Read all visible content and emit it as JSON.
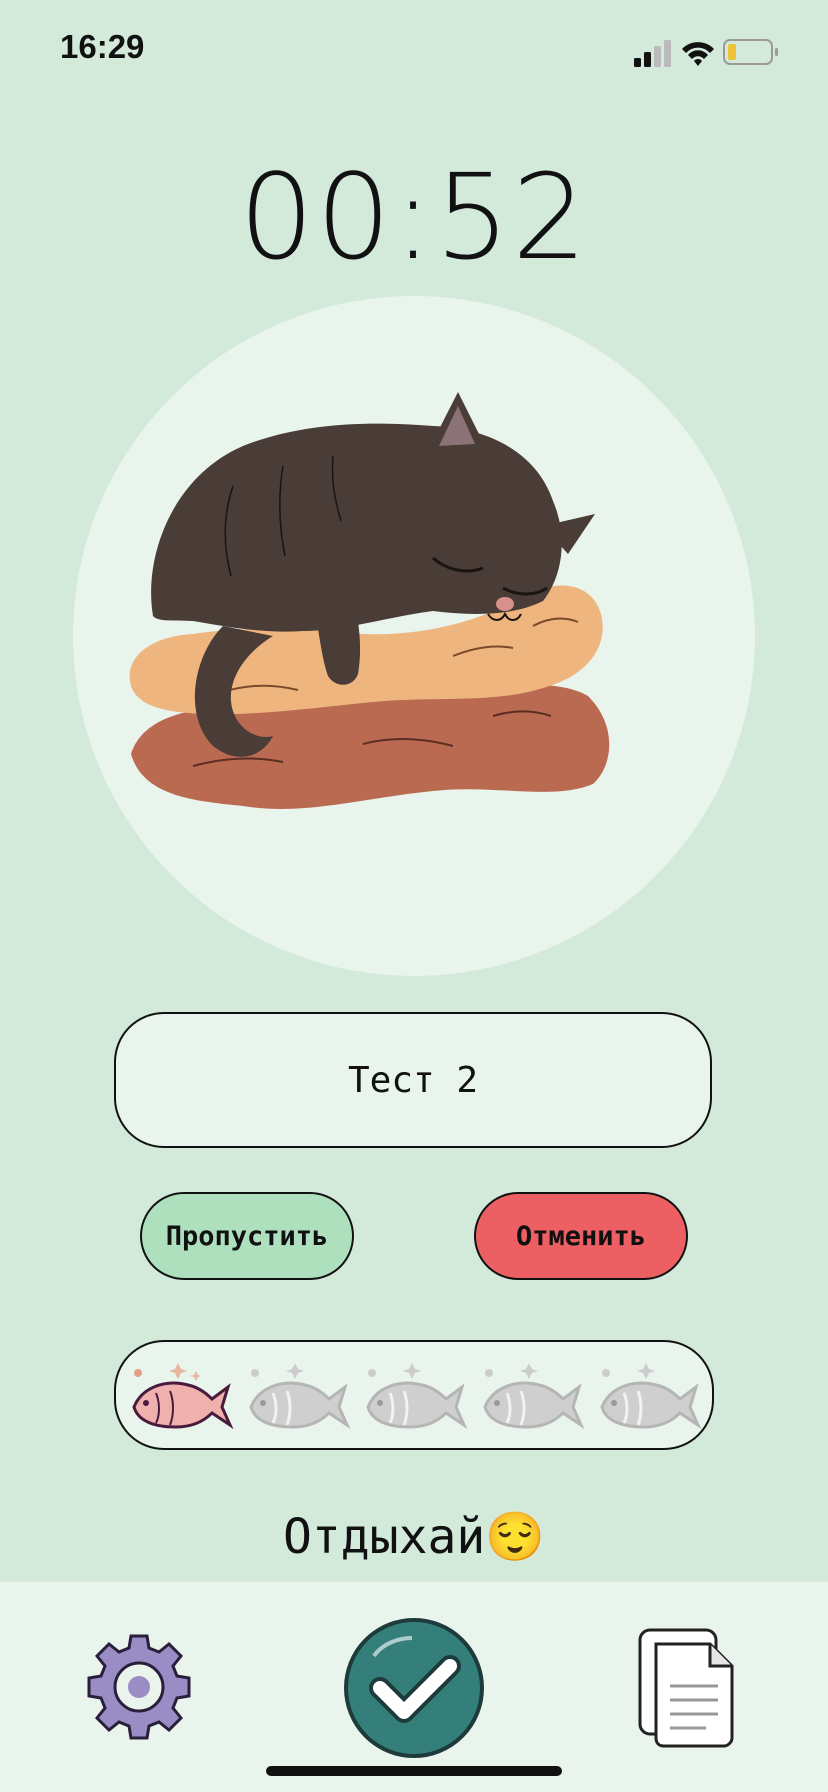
{
  "status_bar": {
    "time": "16:29",
    "icons": [
      "signal-icon",
      "wifi-icon",
      "battery-icon"
    ]
  },
  "timer": {
    "value": "00:52"
  },
  "illustration": {
    "icon": "sleeping-cat-illustration"
  },
  "task": {
    "name": "Тест 2"
  },
  "buttons": {
    "skip_label": "Пропустить",
    "cancel_label": "Отменить"
  },
  "progress": {
    "completed": 1,
    "total": 5,
    "icon": "fish-icon"
  },
  "message": {
    "text": "Отдыхай😌"
  },
  "bottom_nav": {
    "items": [
      "gear-icon",
      "check-icon",
      "documents-icon"
    ]
  },
  "colors": {
    "background": "#d3eadb",
    "panel": "#e8f4ec",
    "skip_button": "#aee0bd",
    "cancel_button": "#ec5f63",
    "check_button": "#357f7b",
    "gear": "#9a8cc4"
  }
}
